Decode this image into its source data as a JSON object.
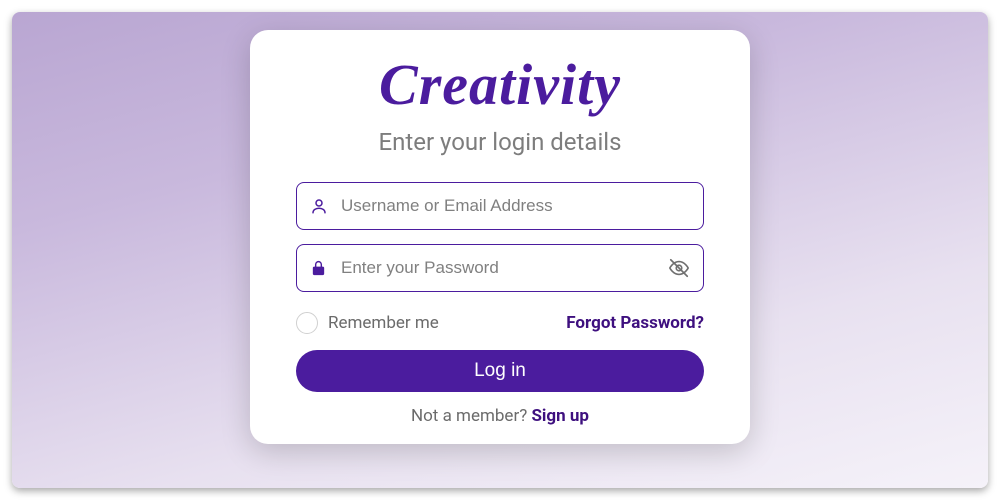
{
  "brand": "Creativity",
  "subtitle": "Enter your login details",
  "inputs": {
    "username_placeholder": "Username or Email Address",
    "password_placeholder": "Enter your Password"
  },
  "options": {
    "remember_label": "Remember me",
    "forgot_label": "Forgot Password?"
  },
  "login_button_label": "Log in",
  "signup": {
    "prompt": "Not a member? ",
    "link": "Sign up"
  },
  "colors": {
    "accent": "#4b1c9e"
  }
}
